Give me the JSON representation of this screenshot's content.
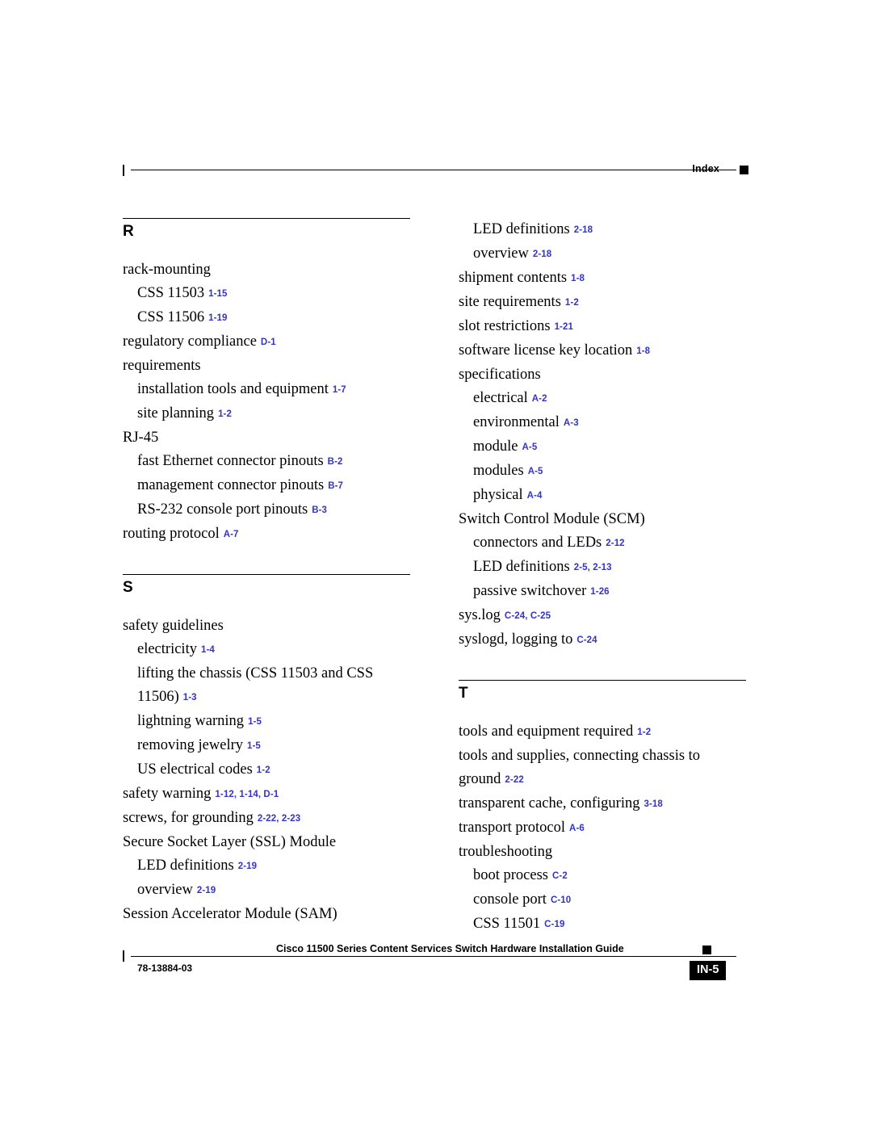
{
  "header": {
    "title": "Index"
  },
  "footer": {
    "book_title": "Cisco 11500 Series Content Services Switch Hardware Installation Guide",
    "doc_number": "78-13884-03",
    "page_label": "IN-5"
  },
  "columns": [
    {
      "id": "left-column",
      "sections": [
        {
          "letter": "R",
          "entries": [
            {
              "level": 0,
              "text": "rack-mounting",
              "pages": ""
            },
            {
              "level": 1,
              "text": "CSS 11503",
              "pages": "1-15"
            },
            {
              "level": 1,
              "text": "CSS 11506",
              "pages": "1-19"
            },
            {
              "level": 0,
              "text": "regulatory compliance",
              "pages": "D-1"
            },
            {
              "level": 0,
              "text": "requirements",
              "pages": ""
            },
            {
              "level": 1,
              "text": "installation tools and equipment",
              "pages": "1-7"
            },
            {
              "level": 1,
              "text": "site planning",
              "pages": "1-2"
            },
            {
              "level": 0,
              "text": "RJ-45",
              "pages": ""
            },
            {
              "level": 1,
              "text": "fast Ethernet connector pinouts",
              "pages": "B-2"
            },
            {
              "level": 1,
              "text": "management connector pinouts",
              "pages": "B-7"
            },
            {
              "level": 1,
              "text": "RS-232 console port pinouts",
              "pages": "B-3"
            },
            {
              "level": 0,
              "text": "routing protocol",
              "pages": "A-7"
            }
          ]
        },
        {
          "letter": "S",
          "entries": [
            {
              "level": 0,
              "text": "safety guidelines",
              "pages": ""
            },
            {
              "level": 1,
              "text": "electricity",
              "pages": "1-4"
            },
            {
              "level": 1,
              "text": "lifting the chassis (CSS 11503 and CSS 11506)",
              "pages": "1-3"
            },
            {
              "level": 1,
              "text": "lightning warning",
              "pages": "1-5"
            },
            {
              "level": 1,
              "text": "removing jewelry",
              "pages": "1-5"
            },
            {
              "level": 1,
              "text": "US electrical codes",
              "pages": "1-2"
            },
            {
              "level": 0,
              "text": "safety warning",
              "pages": "1-12, 1-14, D-1"
            },
            {
              "level": 0,
              "text": "screws, for grounding",
              "pages": "2-22, 2-23"
            },
            {
              "level": 0,
              "text": "Secure Socket Layer (SSL) Module",
              "pages": ""
            },
            {
              "level": 1,
              "text": "LED definitions",
              "pages": "2-19"
            },
            {
              "level": 1,
              "text": "overview",
              "pages": "2-19"
            },
            {
              "level": 0,
              "text": "Session Accelerator Module (SAM)",
              "pages": ""
            }
          ]
        }
      ]
    },
    {
      "id": "right-column",
      "sections": [
        {
          "letter": "",
          "entries": [
            {
              "level": 1,
              "text": "LED definitions",
              "pages": "2-18"
            },
            {
              "level": 1,
              "text": "overview",
              "pages": "2-18"
            },
            {
              "level": 0,
              "text": "shipment contents",
              "pages": "1-8"
            },
            {
              "level": 0,
              "text": "site requirements",
              "pages": "1-2"
            },
            {
              "level": 0,
              "text": "slot restrictions",
              "pages": "1-21"
            },
            {
              "level": 0,
              "text": "software license key location",
              "pages": "1-8"
            },
            {
              "level": 0,
              "text": "specifications",
              "pages": ""
            },
            {
              "level": 1,
              "text": "electrical",
              "pages": "A-2"
            },
            {
              "level": 1,
              "text": "environmental",
              "pages": "A-3"
            },
            {
              "level": 1,
              "text": "module",
              "pages": "A-5"
            },
            {
              "level": 1,
              "text": "modules",
              "pages": "A-5"
            },
            {
              "level": 1,
              "text": "physical",
              "pages": "A-4"
            },
            {
              "level": 0,
              "text": "Switch Control Module (SCM)",
              "pages": ""
            },
            {
              "level": 1,
              "text": "connectors and LEDs",
              "pages": "2-12"
            },
            {
              "level": 1,
              "text": "LED definitions",
              "pages": "2-5, 2-13"
            },
            {
              "level": 1,
              "text": "passive switchover",
              "pages": "1-26"
            },
            {
              "level": 0,
              "text": "sys.log",
              "pages": "C-24, C-25"
            },
            {
              "level": 0,
              "text": "syslogd, logging to",
              "pages": "C-24"
            }
          ]
        },
        {
          "letter": "T",
          "entries": [
            {
              "level": 0,
              "text": "tools and equipment required",
              "pages": "1-2"
            },
            {
              "level": 0,
              "text": "tools and supplies, connecting chassis to ground",
              "pages": "2-22"
            },
            {
              "level": 0,
              "text": "transparent cache, configuring",
              "pages": "3-18"
            },
            {
              "level": 0,
              "text": "transport protocol",
              "pages": "A-6"
            },
            {
              "level": 0,
              "text": "troubleshooting",
              "pages": ""
            },
            {
              "level": 1,
              "text": "boot process",
              "pages": "C-2"
            },
            {
              "level": 1,
              "text": "console port",
              "pages": "C-10"
            },
            {
              "level": 1,
              "text": "CSS 11501",
              "pages": "C-19"
            }
          ]
        }
      ]
    }
  ]
}
